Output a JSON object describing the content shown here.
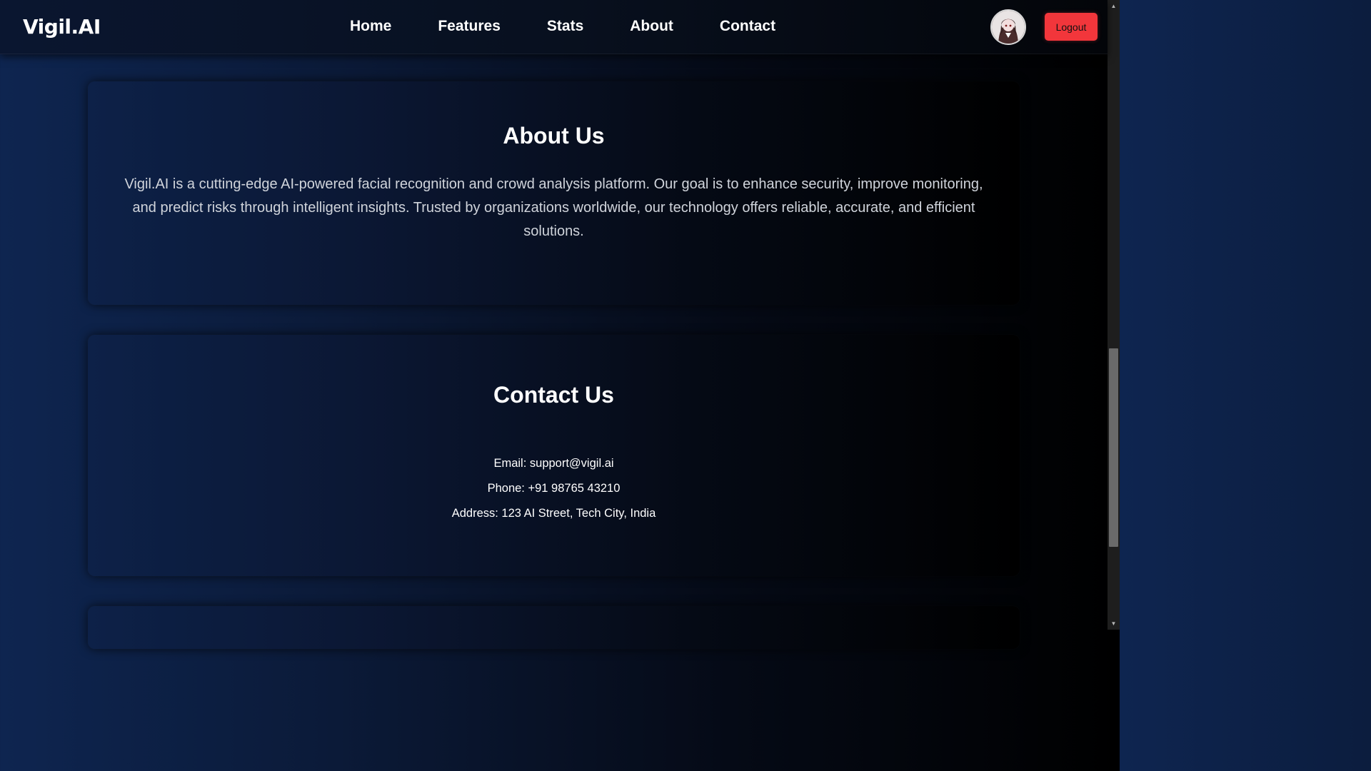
{
  "navbar": {
    "brand": "Vigil.AI",
    "links": [
      "Home",
      "Features",
      "Stats",
      "About",
      "Contact"
    ],
    "logout_label": "Logout",
    "avatar_icon": "user-avatar-icon"
  },
  "about": {
    "title": "About Us",
    "text": "Vigil.AI is a cutting-edge AI-powered facial recognition and crowd analysis platform. Our goal is to enhance security, improve monitoring, and predict risks through intelligent insights. Trusted by organizations worldwide, our technology offers reliable, accurate, and efficient solutions."
  },
  "contact": {
    "title": "Contact Us",
    "email": "Email: support@vigil.ai",
    "phone": "Phone: +91 98765 43210",
    "address": "Address: 123 AI Street, Tech City, India"
  },
  "colors": {
    "logout_bg": "#f2363b",
    "gradient_left": "#0e2550",
    "gradient_right": "#000000"
  }
}
